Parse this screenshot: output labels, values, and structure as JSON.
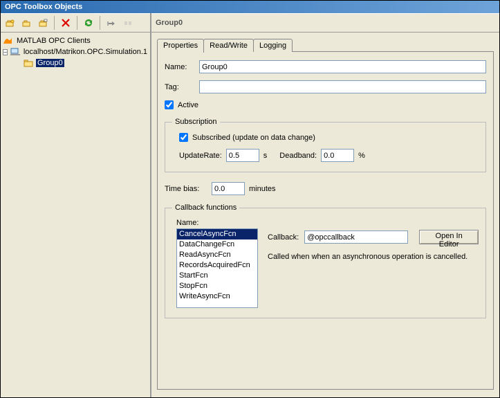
{
  "window": {
    "title": "OPC Toolbox Objects"
  },
  "toolbar": {
    "icons": [
      "add-host-icon",
      "add-group-icon",
      "add-item-icon",
      "delete-icon",
      "refresh-icon",
      "connect-icon",
      "disconnect-icon"
    ]
  },
  "tree": {
    "root": {
      "label": "MATLAB OPC Clients"
    },
    "client": {
      "label": "localhost/Matrikon.OPC.Simulation.1"
    },
    "group": {
      "label": "Group0"
    }
  },
  "rightHeader": "Group0",
  "tabs": {
    "properties": "Properties",
    "readwrite": "Read/Write",
    "logging": "Logging"
  },
  "props": {
    "nameLabel": "Name:",
    "nameValue": "Group0",
    "tagLabel": "Tag:",
    "tagValue": "",
    "activeLabel": "Active"
  },
  "subscription": {
    "legend": "Subscription",
    "subscribedLabel": "Subscribed (update on data change)",
    "updateRateLabel": "UpdateRate:",
    "updateRateValue": "0.5",
    "updateRateUnit": "s",
    "deadbandLabel": "Deadband:",
    "deadbandValue": "0.0",
    "deadbandUnit": "%"
  },
  "timebias": {
    "label": "Time bias:",
    "value": "0.0",
    "unit": "minutes"
  },
  "callbacks": {
    "legend": "Callback functions",
    "nameLabel": "Name:",
    "items": [
      "CancelAsyncFcn",
      "DataChangeFcn",
      "ReadAsyncFcn",
      "RecordsAcquiredFcn",
      "StartFcn",
      "StopFcn",
      "WriteAsyncFcn"
    ],
    "selectedIndex": 0,
    "callbackLabel": "Callback:",
    "callbackValue": "@opccallback",
    "openBtn": "Open In Editor",
    "description": "Called when when an asynchronous operation is cancelled."
  }
}
